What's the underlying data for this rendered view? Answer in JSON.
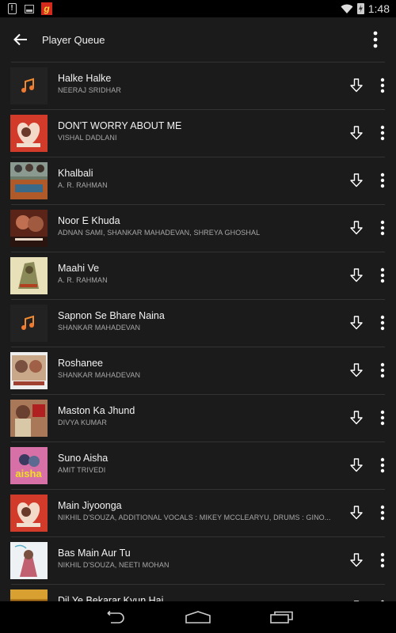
{
  "status_bar": {
    "time": "1:48",
    "left_icons": [
      "notification-alert-icon",
      "image-icon",
      "gaana-app-icon"
    ],
    "right_icons": [
      "wifi-icon",
      "battery-charging-icon"
    ],
    "gaana_glyph": "g"
  },
  "app_bar": {
    "title": "Player Queue",
    "back_icon": "arrow-back-icon",
    "overflow_icon": "more-vert-icon"
  },
  "queue": [
    {
      "title": "Halke Halke",
      "artist": "NEERAJ SRIDHAR",
      "art": "placeholder-note"
    },
    {
      "title": "DON'T WORRY ABOUT ME",
      "artist": "VISHAL DADLANI",
      "art": "befikre-red"
    },
    {
      "title": "Khalbali",
      "artist": "A. R. RAHMAN",
      "art": "rang-de-basanti"
    },
    {
      "title": "Noor E Khuda",
      "artist": "ADNAN SAMI, SHANKAR MAHADEVAN, SHREYA GHOSHAL",
      "art": "my-name-is-khan"
    },
    {
      "title": "Maahi Ve",
      "artist": "A. R. RAHMAN",
      "art": "highway"
    },
    {
      "title": "Sapnon Se Bhare Naina",
      "artist": "SHANKAR MAHADEVAN",
      "art": "placeholder-note"
    },
    {
      "title": "Roshanee",
      "artist": "SHANKAR MAHADEVAN",
      "art": "aarakshan"
    },
    {
      "title": "Maston Ka Jhund",
      "artist": "DIVYA KUMAR",
      "art": "bhaag-milkha-bhaag"
    },
    {
      "title": "Suno Aisha",
      "artist": "AMIT TRIVEDI",
      "art": "aisha"
    },
    {
      "title": "Main Jiyoonga",
      "artist": "NIKHIL D'SOUZA, ADDITIONAL VOCALS : MIKEY MCCLEARYU, DRUMS : GINO...",
      "art": "befikre-red"
    },
    {
      "title": "Bas Main Aur Tu",
      "artist": "NIKHIL D'SOUZA, NEETI MOHAN",
      "art": "akshar-white"
    },
    {
      "title": "Dil Ye Bekarar Kyun Hai",
      "artist": "",
      "art": "players-gold"
    }
  ],
  "row_actions": {
    "download_icon": "download-arrow-icon",
    "more_icon": "more-vert-icon"
  },
  "nav_bar": {
    "buttons": [
      "back-nav",
      "home-nav",
      "recents-nav"
    ]
  }
}
